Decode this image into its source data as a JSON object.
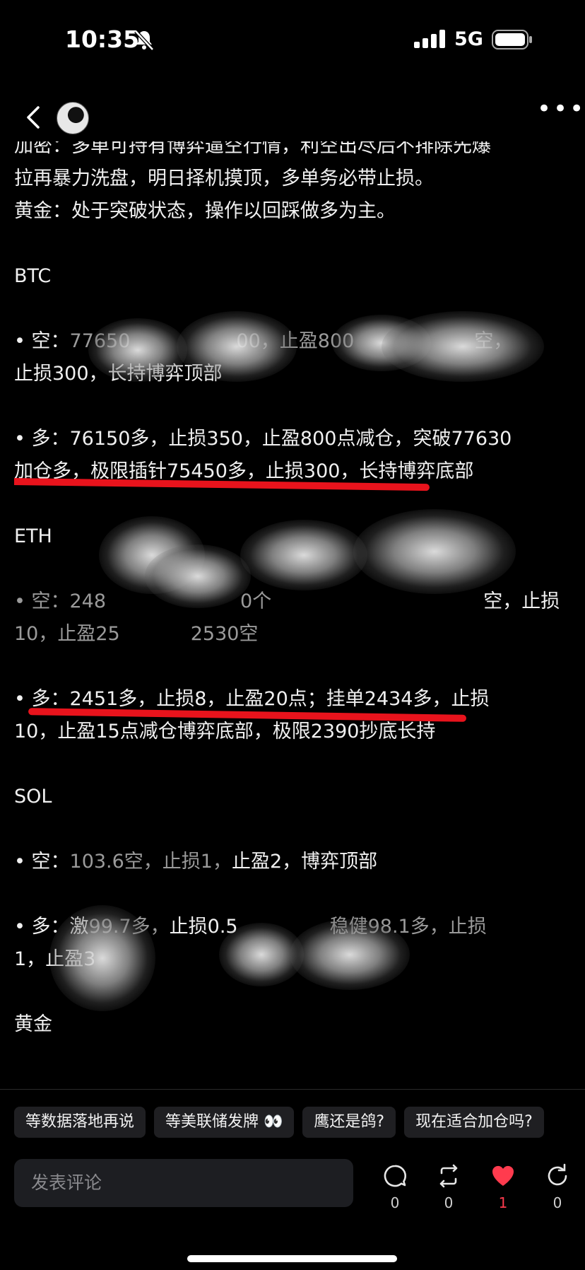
{
  "status_bar": {
    "time": "10:35",
    "network": "5G"
  },
  "post": {
    "lines": {
      "crypto1": "加密：多单可持有博弈逼空行情，利空出尽后不排除先爆",
      "crypto2": "拉再暴力洗盘，明日择机摸顶，多单务必带止损。",
      "gold_summary": "黄金：处于突破状态，操作以回踩做多为主。",
      "btc_title": "BTC",
      "btc_short_a": "• 空：",
      "btc_short_b": "77650",
      "btc_short_c": "00，止盈800",
      "btc_short_d": "空，",
      "btc_short2": "止损300，长持博弈顶部",
      "btc_long1": "• 多：76150多，止损350，止盈800点减仓，突破77630",
      "btc_long2": "加仓多，极限插针75450多，止损300，长持博弈底部",
      "eth_title": "ETH",
      "eth_short_a": "• 空：248",
      "eth_short_b": "0个",
      "eth_short_c": "空，止损",
      "eth_short2a": "10，止盈25",
      "eth_short2b": "2530空",
      "eth_long1": "• 多：2451多，止损8，止盈20点；挂单2434多，止损",
      "eth_long2": "10，止盈15点减仓博弈底部，极限2390抄底长持",
      "sol_title": "SOL",
      "sol_short_a": "• 空：",
      "sol_short_b": "103.6空，止损1，",
      "sol_short_c": "止盈2，博弈顶部",
      "sol_long_a": "• 多：激",
      "sol_long_b": "99.7多，",
      "sol_long_c": "止损0.5",
      "sol_long_d": "稳健98.1多，止损",
      "sol_long2": "1，止盈3",
      "gold_title": "黄金"
    }
  },
  "suggestions": [
    "等数据落地再说",
    "等美联储发牌 👀",
    "鹰还是鸽?",
    "现在适合加仓吗?"
  ],
  "comment_placeholder": "发表评论",
  "actions": {
    "comment_count": "0",
    "repost_count": "0",
    "like_count": "1",
    "share_count": "0"
  },
  "colors": {
    "like": "#ff3b4e",
    "underline": "#e8131c",
    "chip_bg": "#1f1f22"
  }
}
